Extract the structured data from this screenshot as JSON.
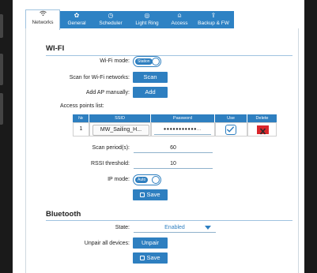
{
  "tabs": [
    {
      "label": "Networks",
      "icon": "wifi-icon"
    },
    {
      "label": "General",
      "icon": "gear-icon"
    },
    {
      "label": "Scheduler",
      "icon": "alarm-clock-icon"
    },
    {
      "label": "Light Ring",
      "icon": "light-ring-icon"
    },
    {
      "label": "Access",
      "icon": "user-icon"
    },
    {
      "label": "Backup & FW",
      "icon": "cloud-upload-icon"
    }
  ],
  "wifi": {
    "title": "WI-FI",
    "mode_label": "Wi-Fi mode:",
    "mode_value": "Station",
    "scan_label": "Scan for Wi-Fi networks:",
    "scan_button": "Scan",
    "add_label": "Add AP manually:",
    "add_button": "Add",
    "ap_list_label": "Access points list:",
    "columns": [
      "№",
      "SSID",
      "Password",
      "Use",
      "Delete"
    ],
    "rows": [
      {
        "num": "1",
        "ssid": "MW_Sailing_H...",
        "password": "●●●●●●●●●●●..."
      }
    ],
    "scan_period_label": "Scan period(s):",
    "scan_period_value": "60",
    "rssi_label": "RSSI threshold:",
    "rssi_value": "10",
    "ip_mode_label": "IP mode:",
    "ip_mode_value": "Auto",
    "save_button": "Save"
  },
  "bluetooth": {
    "title": "Bluetooth",
    "state_label": "State:",
    "state_value": "Enabled",
    "unpair_label": "Unpair all devices:",
    "unpair_button": "Unpair",
    "save_button": "Save"
  },
  "colors": {
    "accent": "#2e7fc0",
    "delete": "#d9262c"
  }
}
